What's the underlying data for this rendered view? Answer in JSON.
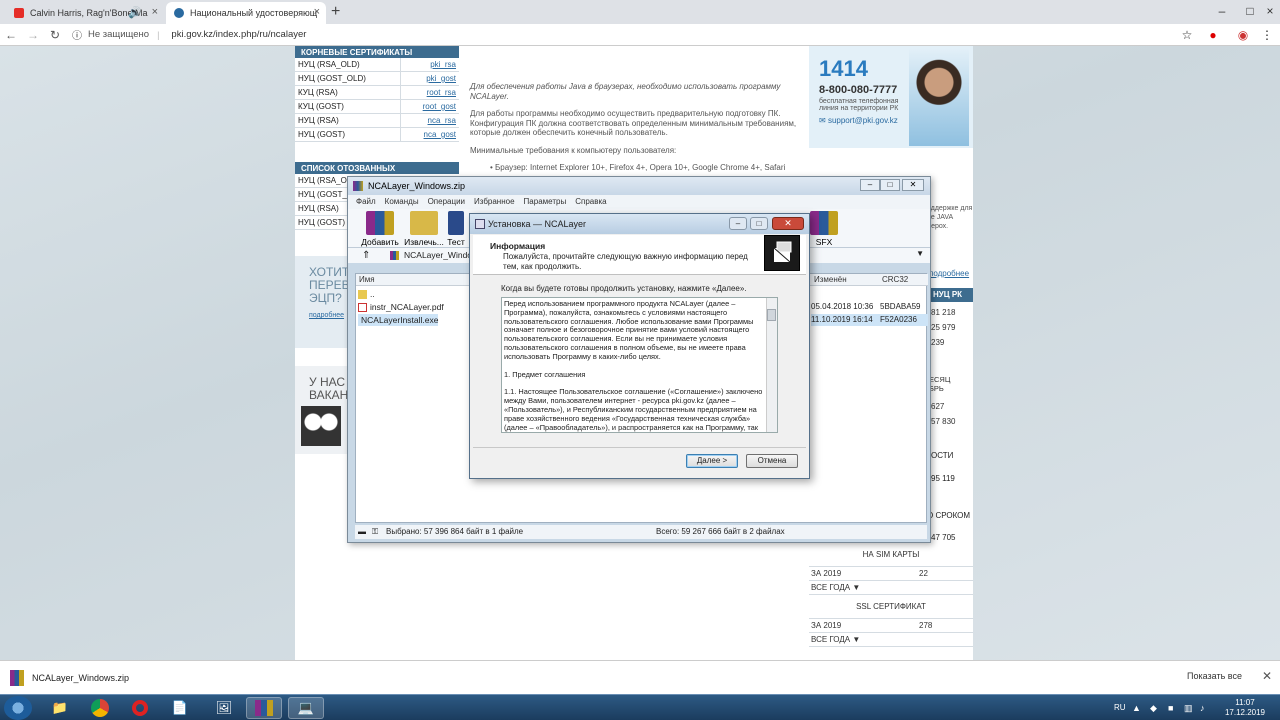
{
  "browser": {
    "tabs": [
      {
        "title": "Calvin Harris, Rag'n'Bone Ma"
      },
      {
        "title": "Национальный удостоверяющ"
      }
    ],
    "not_secure": "Не защищено",
    "url": "pki.gov.kz/index.php/ru/ncalayer"
  },
  "left": {
    "root_header": "КОРНЕВЫЕ СЕРТИФИКАТЫ",
    "certs": [
      {
        "name": "НУЦ (RSA_OLD)",
        "link": "pki_rsa"
      },
      {
        "name": "НУЦ (GOST_OLD)",
        "link": "pki_gost"
      },
      {
        "name": "КУЦ (RSA)",
        "link": "root_rsa"
      },
      {
        "name": "КУЦ (GOST)",
        "link": "root_gost"
      },
      {
        "name": "НУЦ (RSA)",
        "link": "nca_rsa"
      },
      {
        "name": "НУЦ (GOST)",
        "link": "nca_gost"
      }
    ],
    "revoked_header": "СПИСОК ОТОЗВАННЫХ СЕРТИФИКАТОВ",
    "revoked": [
      "НУЦ (RSA_OL",
      "НУЦ (GOST_O",
      "НУЦ (RSA)",
      "НУЦ (GOST)"
    ],
    "banner1_lines": [
      "ХОТИТ",
      "ПЕРЕВ",
      "ЭЦП?"
    ],
    "banner1_link": "подробнее",
    "banner2_lines": [
      "У НАС",
      "ВАКАН"
    ]
  },
  "main": {
    "p1": "Для обеспечения работы Java в браузерах, необходимо использовать программу NCALayer.",
    "p2": "Для работы программы необходимо осуществить предварительную подготовку ПК. Конфигурация ПК должна соответствовать определенным минимальным требованиям, которые должен обеспечить конечный пользователь.",
    "p3": "Минимальные требования к компьютеру пользователя:",
    "p4": "• Браузер: Internet Explorer 10+, Firefox 4+, Opera 10+, Google Chrome 4+, Safari"
  },
  "right": {
    "hotline_short": "1414",
    "hotline_phone": "8-800-080-7777",
    "hotline_desc": "бесплатная телефонная линия на территории РК",
    "support_email": "support@pki.gov.kz",
    "partial_text": [
      "оддержке для",
      "не JAVA",
      "лерох."
    ],
    "partial_link": "подробнее",
    "nuc_header": "НУЦ РК",
    "numbers": [
      "81 218",
      "25 979",
      "239"
    ],
    "month_label": [
      "ЕСЯЦ",
      "БРЬ"
    ],
    "month_vals": [
      "627",
      "57 830"
    ],
    "osti": "ОСТИ",
    "osti_val": "95 119",
    "srok": "О СРОКОМ",
    "srok_val": "47 705",
    "sim_header": "НА SIM КАРТЫ",
    "sim_year": "ЗА 2019",
    "sim_year_val": "22",
    "sim_all": "ВСЕ ГОДА ▼",
    "ssl_header": "SSL СЕРТИФИКАТ",
    "ssl_year": "ЗА 2019",
    "ssl_year_val": "278",
    "ssl_all": "ВСЕ ГОДА ▼"
  },
  "winrar": {
    "title": "NCALayer_Windows.zip",
    "menu": [
      "Файл",
      "Команды",
      "Операции",
      "Избранное",
      "Параметры",
      "Справка"
    ],
    "tools": [
      "Добавить",
      "Извлечь...",
      "Тест",
      "SFX"
    ],
    "path": "NCALayer_Windows",
    "col_name": "Имя",
    "col_modified": "Изменён",
    "col_crc": "CRC32",
    "files": [
      {
        "name": "..",
        "date": "",
        "crc": ""
      },
      {
        "name": "instr_NCALayer.pdf",
        "date": "05.04.2018 10:36",
        "crc": "5BDABA59"
      },
      {
        "name": "NCALayerInstall.exe",
        "date": "11.10.2019 16:14",
        "crc": "F52A0236"
      }
    ],
    "status_selected": "Выбрано: 57 396 864 байт в 1 файле",
    "status_total": "Всего: 59 267 666 байт в 2 файлах"
  },
  "setup": {
    "title": "Установка — NCALayer",
    "heading": "Информация",
    "subheading": "Пожалуйста, прочитайте следующую важную информацию перед тем, как продолжить.",
    "lead": "Когда вы будете готовы продолжить установку, нажмите «Далее».",
    "license_p1": "Перед использованием программного продукта NCALayer (далее – Программа), пожалуйста, ознакомьтесь с условиями настоящего пользовательского соглашения. Любое использование вами Программы означает полное и безоговорочное принятие вами условий настоящего пользовательского соглашения. Если вы не принимаете условия пользовательского соглашения в полном объеме, вы не имеете права использовать Программу в каких-либо целях.",
    "license_p2": "1. Предмет соглашения",
    "license_p3": "1.1. Настоящее Пользовательское соглашение («Соглашение») заключено между Вами, пользователем интернет - ресурса pki.gov.kz (далее – «Пользователь»), и Республиканским государственным предприятием на праве хозяйственного ведения «Государственная техническая служба» (далее – «Правообладатель»), и распространяется как на Программу, так и",
    "next": "Далее >",
    "cancel": "Отмена"
  },
  "download": {
    "file": "NCALayer_Windows.zip",
    "show_all": "Показать все"
  },
  "taskbar": {
    "lang": "RU",
    "time": "11:07",
    "date": "17.12.2019"
  }
}
